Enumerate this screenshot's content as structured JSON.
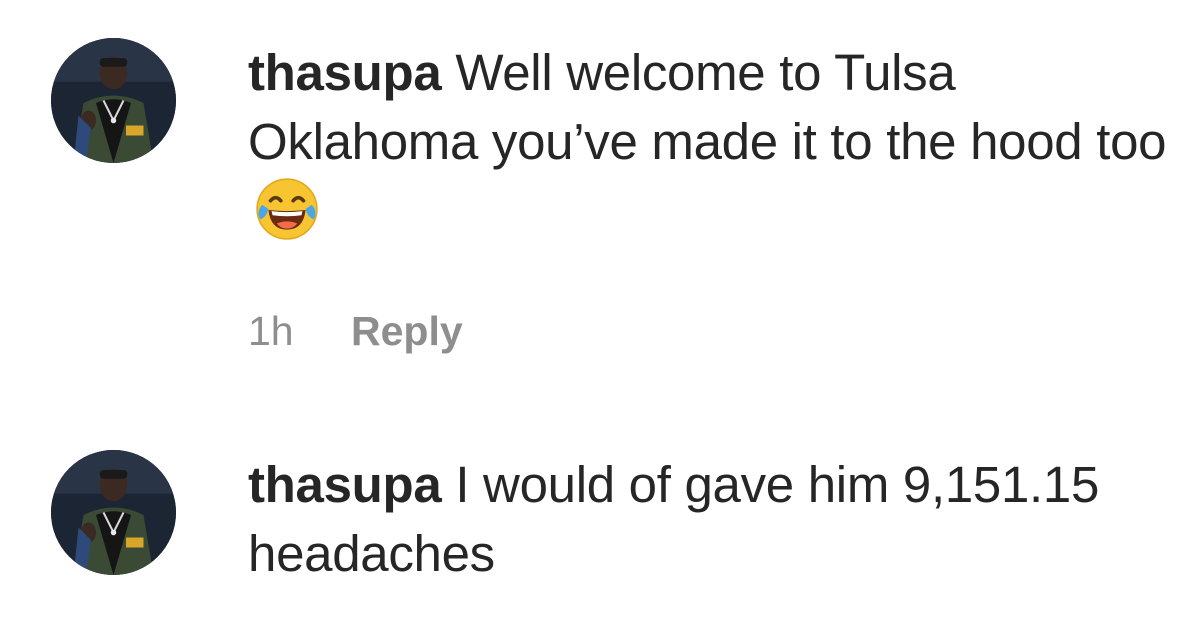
{
  "comments": [
    {
      "username": "thasupa",
      "text": "Well welcome to Tulsa Oklahoma you’ve made it to the hood too",
      "emoji": "face-with-tears-of-joy",
      "timestamp": "1h",
      "reply_label": "Reply"
    },
    {
      "username": "thasupa",
      "text": "I would of gave him 9,151.15 headaches"
    }
  ],
  "colors": {
    "primary_text": "#262626",
    "secondary_text": "#8e8e8e",
    "background": "#ffffff"
  }
}
